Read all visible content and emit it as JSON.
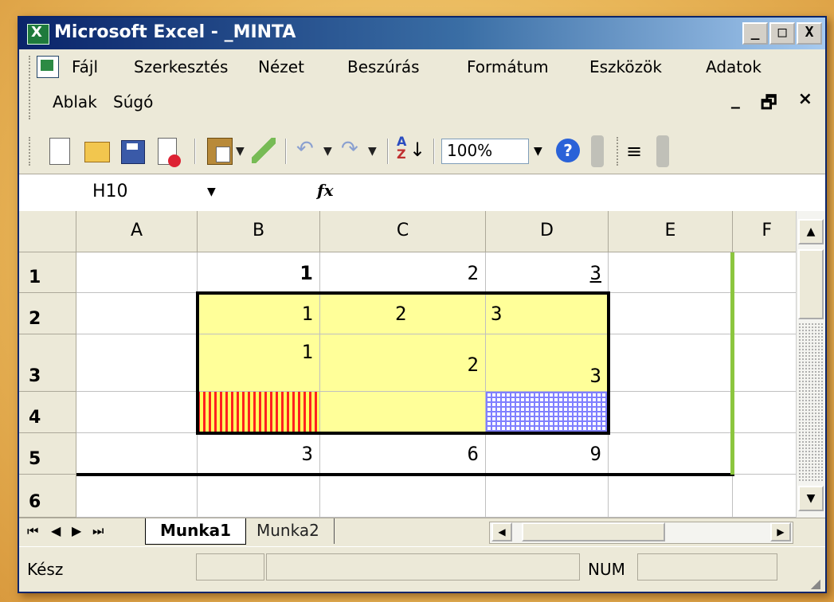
{
  "window": {
    "title": "Microsoft Excel - _MINTA",
    "buttons": [
      "_",
      "□",
      "X"
    ]
  },
  "menu": {
    "items": [
      "Fájl",
      "Szerkesztés",
      "Nézet",
      "Beszúrás",
      "Formátum",
      "Eszközök",
      "Adatok",
      "Ablak",
      "Súgó"
    ],
    "mdi_buttons": [
      "_",
      "🗗",
      "×"
    ]
  },
  "toolbar": {
    "zoom": "100%",
    "icons": [
      "new-icon",
      "open-icon",
      "save-icon",
      "print-preview-icon",
      "paste-icon",
      "format-painter-icon",
      "undo-icon",
      "redo-icon",
      "sort-ascending-icon",
      "help-icon",
      "align-left-icon"
    ]
  },
  "formula_bar": {
    "name_box": "H10",
    "fx_label": "fx",
    "content": ""
  },
  "grid": {
    "columns": [
      "A",
      "B",
      "C",
      "D",
      "E",
      "F"
    ],
    "rows": [
      "1",
      "2",
      "3",
      "4",
      "5",
      "6"
    ],
    "cells": {
      "B1": "1",
      "C1": "2",
      "D1": "3",
      "B2": "1",
      "C2": "2",
      "D2": "3",
      "B3": "1",
      "C3": "2",
      "D3": "3",
      "B5": "3",
      "C5": "6",
      "D5": "9"
    },
    "fill_colors": {
      "yellow": "#ffff99",
      "red_stripe": "#ff2020",
      "blue_check": "#8080ff",
      "green_border": "#8cc63f"
    }
  },
  "sheets": {
    "active": "Munka1",
    "others": [
      "Munka2"
    ]
  },
  "status": {
    "ready": "Kész",
    "num": "NUM"
  }
}
